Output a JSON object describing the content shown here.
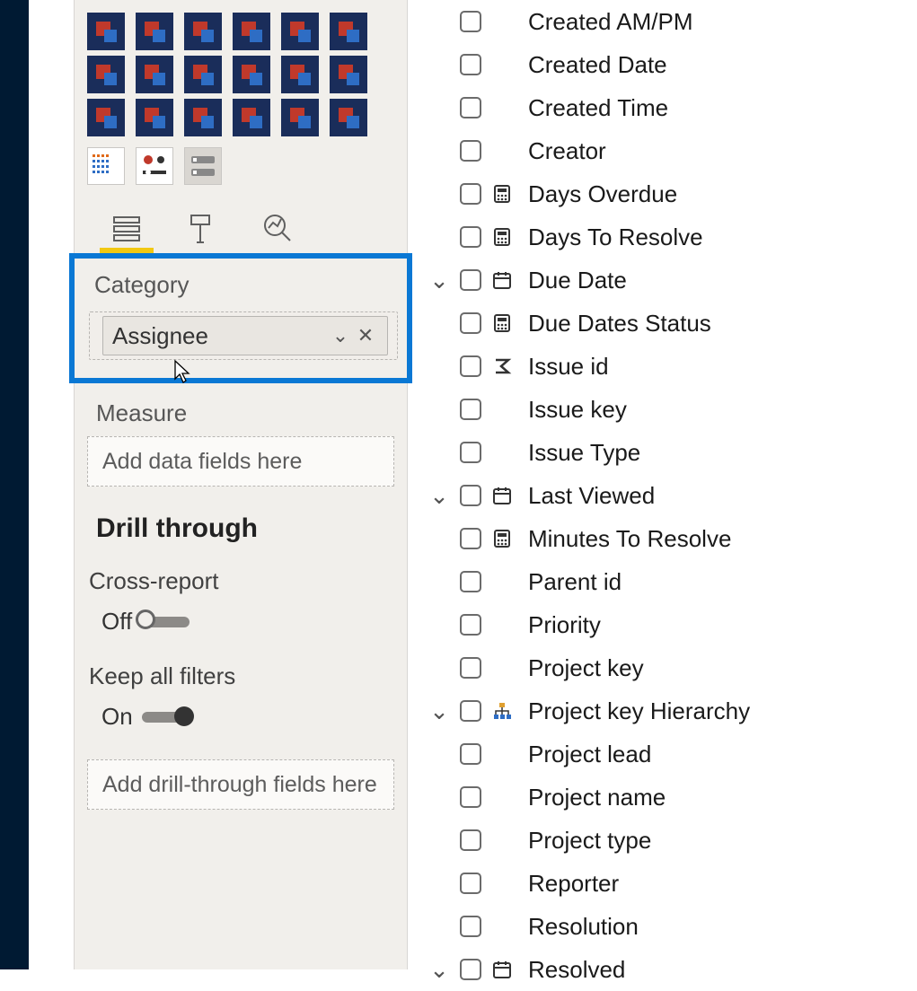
{
  "fieldWells": {
    "categoryLabel": "Category",
    "categoryField": "Assignee",
    "measureLabel": "Measure",
    "measurePlaceholder": "Add data fields here"
  },
  "drillThrough": {
    "heading": "Drill through",
    "crossReport": {
      "label": "Cross-report",
      "stateText": "Off"
    },
    "keepAllFilters": {
      "label": "Keep all filters",
      "stateText": "On"
    },
    "dropPlaceholder": "Add drill-through fields here"
  },
  "fieldsList": [
    {
      "name": "Created AM/PM"
    },
    {
      "name": "Created Date"
    },
    {
      "name": "Created Time"
    },
    {
      "name": "Creator"
    },
    {
      "name": "Days Overdue",
      "icon": "calc"
    },
    {
      "name": "Days To Resolve",
      "icon": "calc"
    },
    {
      "name": "Due Date",
      "icon": "date",
      "expandable": true
    },
    {
      "name": "Due Dates Status",
      "icon": "calc"
    },
    {
      "name": "Issue id",
      "icon": "sigma"
    },
    {
      "name": "Issue key"
    },
    {
      "name": "Issue Type"
    },
    {
      "name": "Last Viewed",
      "icon": "date",
      "expandable": true
    },
    {
      "name": "Minutes To Resolve",
      "icon": "calc"
    },
    {
      "name": "Parent id"
    },
    {
      "name": "Priority"
    },
    {
      "name": "Project key"
    },
    {
      "name": "Project key Hierarchy",
      "icon": "hier",
      "expandable": true
    },
    {
      "name": "Project lead"
    },
    {
      "name": "Project name"
    },
    {
      "name": "Project type"
    },
    {
      "name": "Reporter"
    },
    {
      "name": "Resolution"
    },
    {
      "name": "Resolved",
      "icon": "date",
      "expandable": true
    }
  ]
}
